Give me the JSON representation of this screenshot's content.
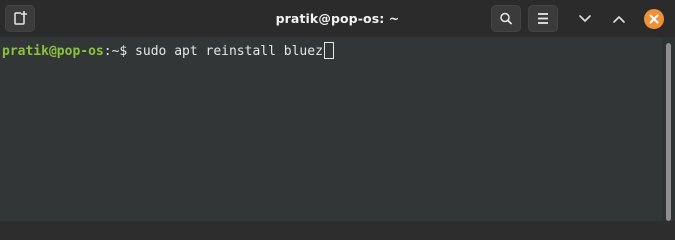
{
  "window": {
    "title": "pratik@pop-os: ~"
  },
  "titlebar": {
    "new_tab_icon": "new-tab-icon",
    "search_icon": "search-icon",
    "menu_icon": "hamburger-menu-icon",
    "scroll_down_icon": "chevron-down-icon",
    "scroll_up_icon": "chevron-up-icon",
    "close_icon": "close-icon",
    "close_color": "#f0913a"
  },
  "terminal": {
    "prompt_user_host": "pratik@pop-os",
    "prompt_separator": ":",
    "prompt_path": "~",
    "prompt_symbol": "$",
    "command": " sudo apt reinstall bluez",
    "prompt_color": "#8ac43a",
    "background": "#333637"
  }
}
